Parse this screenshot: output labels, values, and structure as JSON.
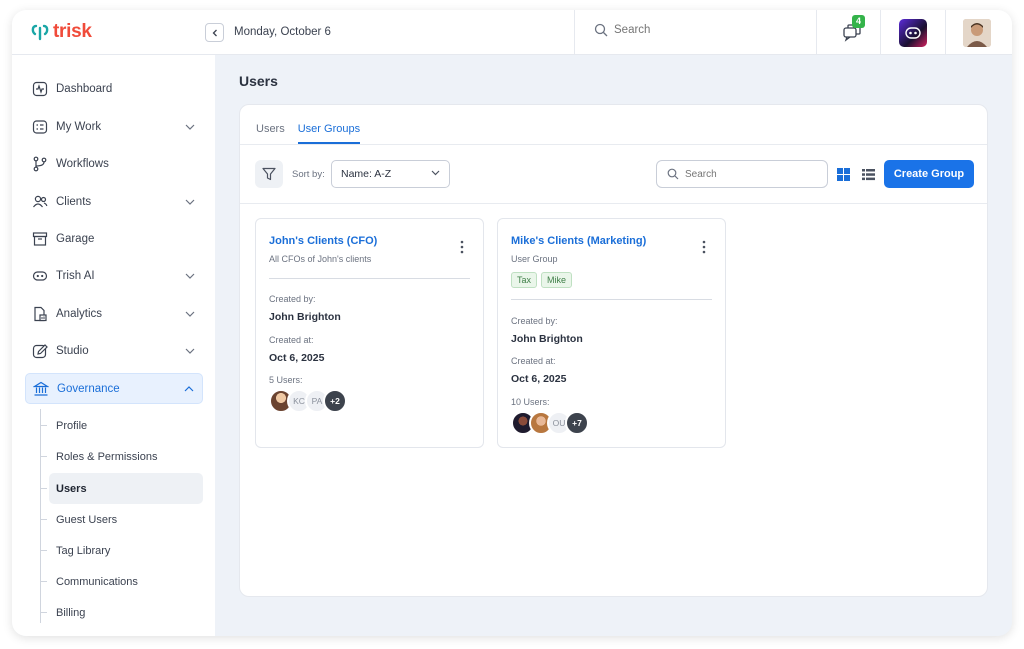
{
  "app": {
    "name": "trisk"
  },
  "topbar": {
    "date": "Monday, October 6",
    "search_placeholder": "Search",
    "notification_count": "4",
    "colors": {
      "brand": "#f04b3a",
      "accent": "#1a73e8",
      "badge": "#34b34a"
    }
  },
  "sidebar": {
    "items": [
      {
        "label": "Dashboard",
        "icon": "pulse-icon"
      },
      {
        "label": "My Work",
        "icon": "checklist-icon"
      },
      {
        "label": "Workflows",
        "icon": "branch-icon"
      },
      {
        "label": "Clients",
        "icon": "users-icon"
      },
      {
        "label": "Garage",
        "icon": "archive-icon"
      },
      {
        "label": "Trish AI",
        "icon": "robot-icon"
      },
      {
        "label": "Analytics",
        "icon": "report-icon"
      },
      {
        "label": "Studio",
        "icon": "pen-icon"
      },
      {
        "label": "Governance",
        "icon": "bank-icon"
      }
    ],
    "sub_items": [
      {
        "label": "Profile"
      },
      {
        "label": "Roles & Permissions"
      },
      {
        "label": "Users"
      },
      {
        "label": "Guest Users"
      },
      {
        "label": "Tag Library"
      },
      {
        "label": "Communications"
      },
      {
        "label": "Billing"
      }
    ]
  },
  "main": {
    "title": "Users",
    "tabs": [
      {
        "label": "Users"
      },
      {
        "label": "User Groups"
      }
    ],
    "sort_label": "Sort by:",
    "sort_value": "Name: A-Z",
    "search_placeholder": "Search",
    "create_button": "Create Group",
    "cards": [
      {
        "title": "John's Clients (CFO)",
        "subtitle": "All CFOs of John's clients",
        "created_by_label": "Created by:",
        "created_by": "John Brighton",
        "created_at_label": "Created at:",
        "created_at": "Oct 6, 2025",
        "users_label": "5 Users:",
        "avatars": [
          "",
          "KC",
          "PA",
          "+2"
        ]
      },
      {
        "title": "Mike's Clients (Marketing)",
        "subtitle": "User Group",
        "tags": [
          "Tax",
          "Mike"
        ],
        "created_by_label": "Created by:",
        "created_by": "John Brighton",
        "created_at_label": "Created at:",
        "created_at": "Oct 6, 2025",
        "users_label": "10 Users:",
        "avatars": [
          "",
          "",
          "OU",
          "+7"
        ]
      }
    ]
  }
}
